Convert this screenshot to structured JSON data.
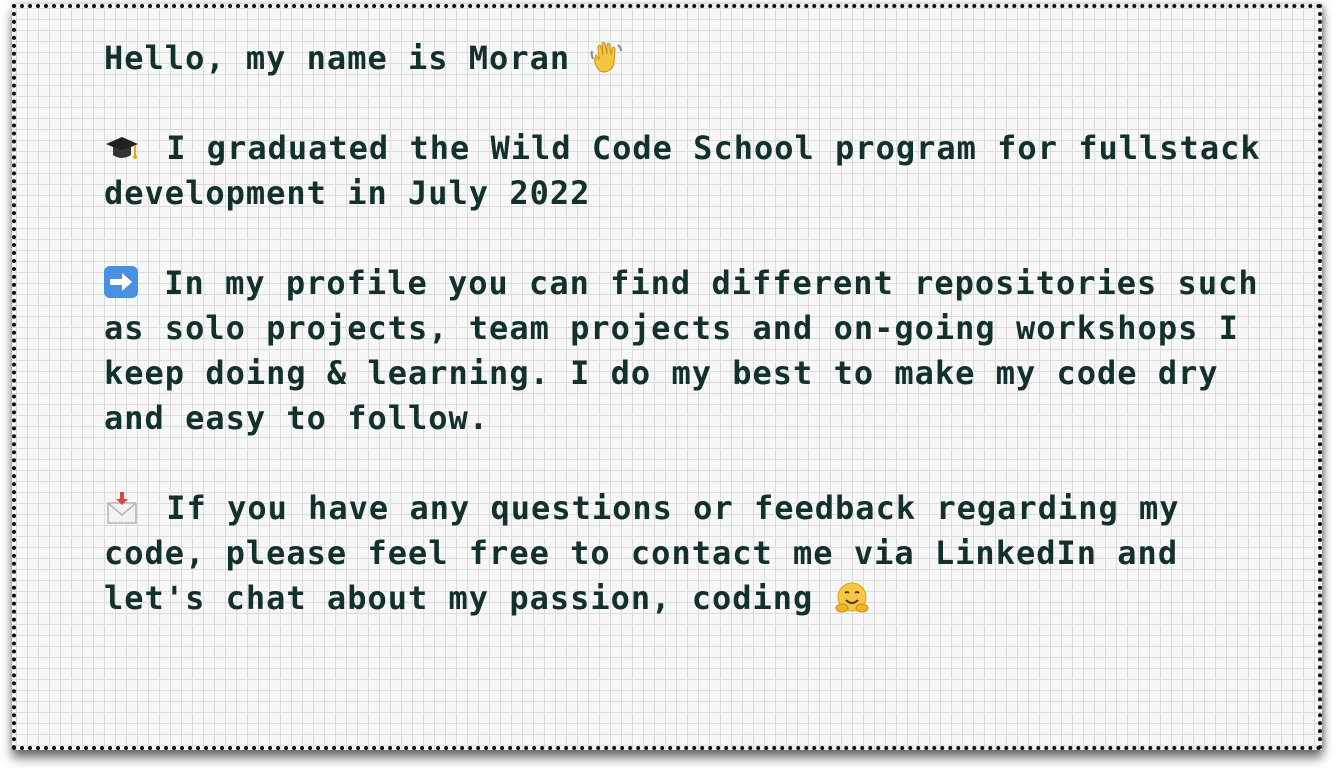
{
  "bio": {
    "greeting": "Hello, my name is Moran",
    "greeting_icon": "waving-hand-icon",
    "graduation_icon": "graduation-cap-icon",
    "graduation": "I graduated the Wild Code School program for fullstack development in July 2022",
    "profile_icon": "right-arrow-icon",
    "profile": "In my profile you can find different repositories such as solo projects, team projects and on-going workshops I keep doing & learning. I do my best to make my code dry and easy to follow.",
    "contact_icon": "incoming-envelope-icon",
    "contact": "If you have any questions or feedback regarding my code, please feel free to contact me via LinkedIn and let's chat about my passion, coding",
    "hug_icon": "hugging-face-icon"
  },
  "colors": {
    "text": "#12302c",
    "grid": "#dcdcdc",
    "border": "#111111",
    "arrow_box": "#4a90e2"
  }
}
